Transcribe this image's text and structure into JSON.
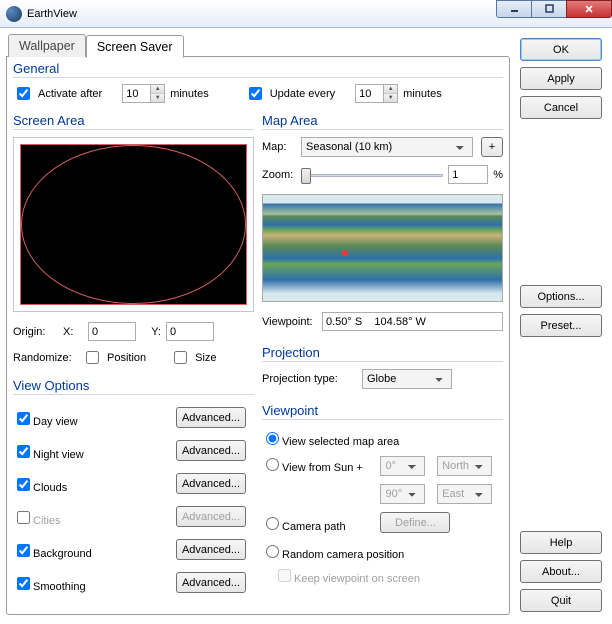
{
  "window": {
    "title": "EarthView"
  },
  "buttons": {
    "ok": "OK",
    "apply": "Apply",
    "cancel": "Cancel",
    "options": "Options...",
    "preset": "Preset...",
    "help": "Help",
    "about": "About...",
    "quit": "Quit",
    "advanced": "Advanced...",
    "define": "Define...",
    "plus": "+"
  },
  "tabs": {
    "wallpaper": "Wallpaper",
    "screensaver": "Screen Saver"
  },
  "general": {
    "title": "General",
    "activate_after": "Activate after",
    "activate_checked": true,
    "activate_value": "10",
    "update_every": "Update every",
    "update_checked": true,
    "update_value": "10",
    "minutes": "minutes"
  },
  "screen_area": {
    "title": "Screen Area",
    "origin": "Origin:",
    "x_label": "X:",
    "x_value": "0",
    "y_label": "Y:",
    "y_value": "0",
    "randomize": "Randomize:",
    "position": "Position",
    "position_checked": false,
    "size": "Size",
    "size_checked": false
  },
  "view_options": {
    "title": "View Options",
    "day": "Day view",
    "day_checked": true,
    "night": "Night view",
    "night_checked": true,
    "clouds": "Clouds",
    "clouds_checked": true,
    "cities": "Cities",
    "cities_checked": false,
    "background": "Background",
    "background_checked": true,
    "smoothing": "Smoothing",
    "smoothing_checked": true
  },
  "map_area": {
    "title": "Map Area",
    "map_label": "Map:",
    "map_value": "Seasonal (10 km)",
    "zoom_label": "Zoom:",
    "zoom_value": "1",
    "zoom_pct": "%",
    "viewpoint_label": "Viewpoint:",
    "viewpoint_value": "0.50° S    104.58° W"
  },
  "projection": {
    "title": "Projection",
    "type_label": "Projection type:",
    "type_value": "Globe"
  },
  "viewpoint": {
    "title": "Viewpoint",
    "selected": "View selected map area",
    "from_sun": "View from Sun +",
    "sun_deg1": "0°",
    "sun_dir1": "North",
    "sun_deg2": "90°",
    "sun_dir2": "East",
    "camera_path": "Camera path",
    "random": "Random camera position",
    "keep": "Keep viewpoint on screen",
    "keep_checked": false,
    "radio_selected_checked": true,
    "radio_sun_checked": false,
    "radio_camera_checked": false,
    "radio_random_checked": false
  }
}
